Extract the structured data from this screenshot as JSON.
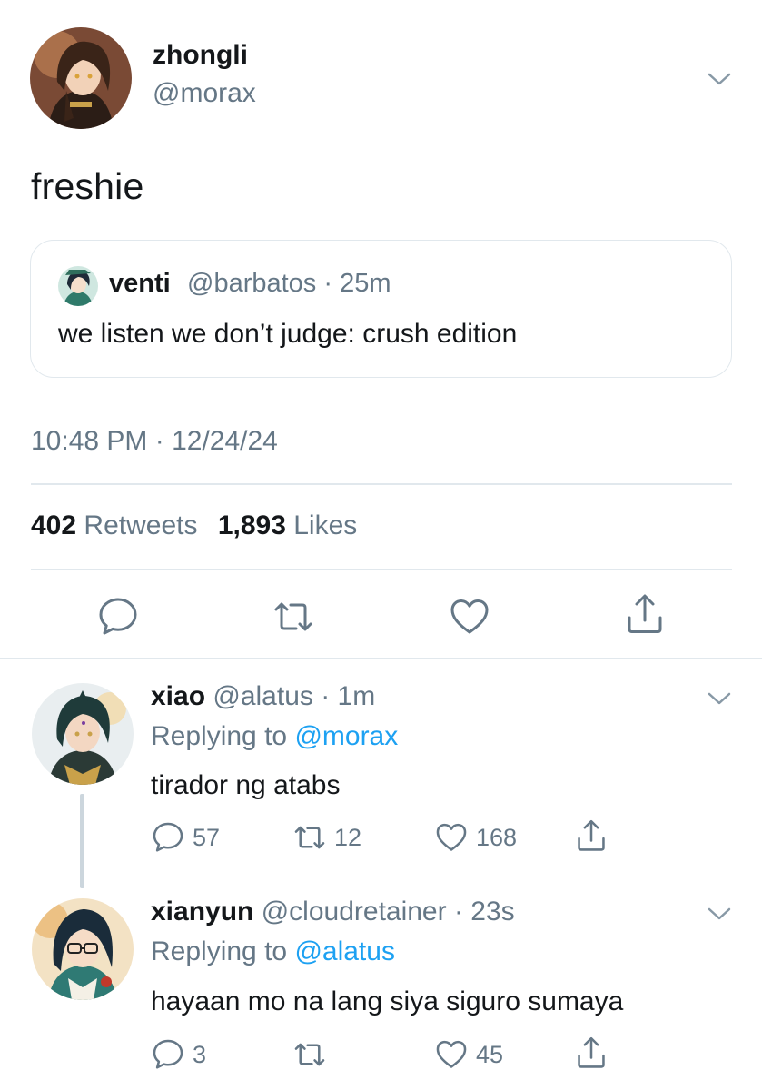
{
  "main_tweet": {
    "name": "zhongli",
    "handle": "@morax",
    "text": "freshie",
    "quote": {
      "name": "venti",
      "handle_time": "@barbatos · 25m",
      "text": "we listen we don’t judge: crush edition"
    },
    "timestamp": "10:48 PM · 12/24/24",
    "retweets": "402",
    "retweets_label": "Retweets",
    "likes": "1,893",
    "likes_label": "Likes"
  },
  "replies": [
    {
      "name": "xiao",
      "handle_time": "@alatus · 1m",
      "replying_prefix": "Replying to",
      "replying_to": "@morax",
      "text": "tirador ng atabs",
      "replies": "57",
      "retweets": "12",
      "likes": "168"
    },
    {
      "name": "xianyun",
      "handle_time": "@cloudretainer · 23s",
      "replying_prefix": "Replying to",
      "replying_to": "@alatus",
      "text": "hayaan mo na lang siya siguro sumaya",
      "replies": "3",
      "retweets": "",
      "likes": "45"
    }
  ],
  "colors": {
    "accent": "#1da1f2",
    "secondary_text": "#657786",
    "border": "#e1e8ed"
  },
  "icons": [
    "chevron-down-icon",
    "reply-icon",
    "retweet-icon",
    "like-icon",
    "share-icon"
  ]
}
